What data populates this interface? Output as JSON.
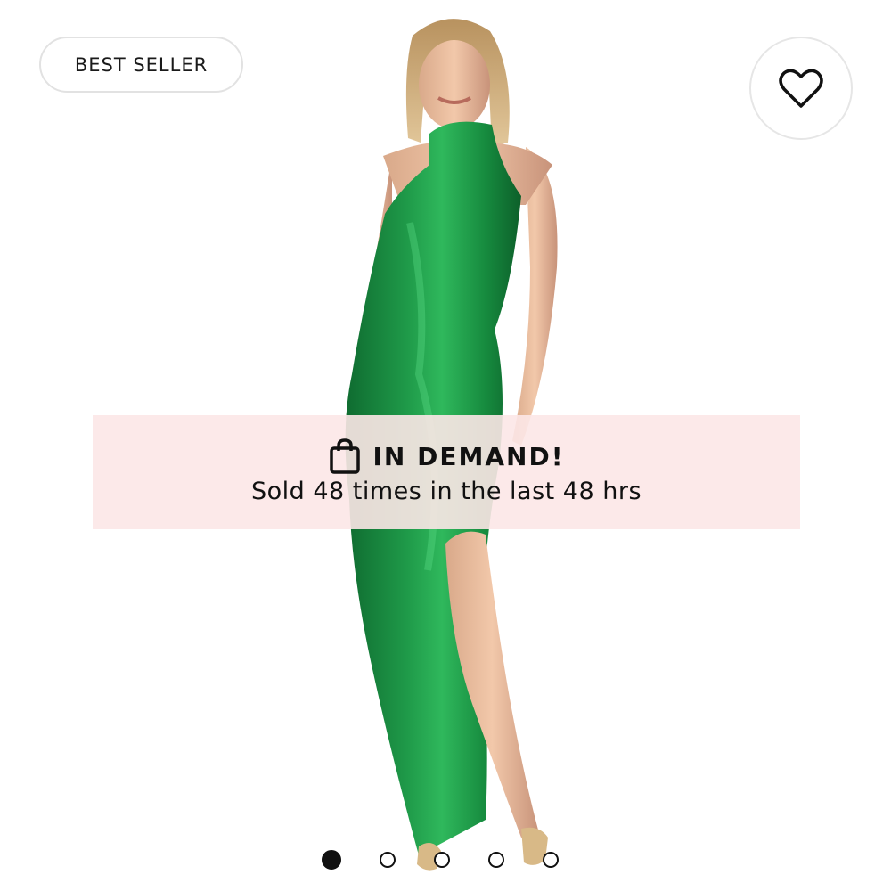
{
  "product": {
    "badge_label": "BEST SELLER",
    "image_alt": "Green satin halter maxi dress",
    "dress_color": "#1f8a42"
  },
  "favorite": {
    "icon": "heart-outline-icon"
  },
  "demand_banner": {
    "icon": "shopping-bag-icon",
    "title": "IN DEMAND!",
    "subtitle": "Sold 48 times in the last 48 hrs",
    "background": "#fde7e7"
  },
  "carousel": {
    "total": 5,
    "active_index": 0,
    "dots": [
      true,
      false,
      false,
      false,
      false
    ]
  }
}
